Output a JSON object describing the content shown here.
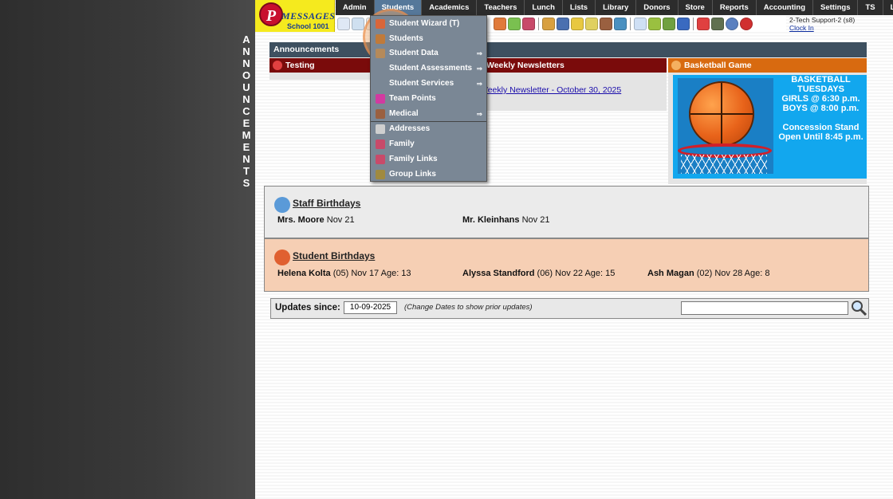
{
  "vertical_title": [
    "A",
    "N",
    "N",
    "O",
    "U",
    "N",
    "C",
    "E",
    "M",
    "E",
    "N",
    "T",
    "S"
  ],
  "logo": {
    "letter": "P",
    "brand": "MESSAGES",
    "school": "School 1001"
  },
  "nav": [
    "Admin",
    "Students",
    "Academics",
    "Teachers",
    "Lunch",
    "Lists",
    "Library",
    "Donors",
    "Store",
    "Reports",
    "Accounting",
    "Settings",
    "TS",
    "Logout"
  ],
  "user": {
    "name": "2-Tech Support-2 (s8)",
    "clock_in": "Clock In"
  },
  "announcements": {
    "title": "Announcements",
    "panels": [
      {
        "title": "Testing",
        "color": "#7a0b0b"
      },
      {
        "title": "Weekly Newsletters",
        "color": "#7a0b0b"
      },
      {
        "title": "Basketball Game",
        "color": "#d86a10"
      }
    ],
    "newsletter_link": "Weekly Newsletter - October 30, 2025",
    "basketball_text": [
      "BASKETBALL",
      "TUESDAYS",
      "GIRLS @ 6:30 p.m.",
      "BOYS  @ 8:00 p.m.",
      "",
      "Concession Stand",
      "Open Until 8:45 p.m."
    ]
  },
  "staff_birthdays": {
    "title": "Staff Birthdays",
    "entries": [
      {
        "name": "Mrs. Moore",
        "detail": "Nov 21"
      },
      {
        "name": "Mr. Kleinhans",
        "detail": "Nov 21"
      }
    ]
  },
  "student_birthdays": {
    "title": "Student Birthdays",
    "entries": [
      {
        "name": "Helena Kolta",
        "detail": "(05) Nov 17 Age: 13"
      },
      {
        "name": "Alyssa Standford",
        "detail": "(06) Nov 22 Age: 15"
      },
      {
        "name": "Ash Magan",
        "detail": "(02) Nov 28 Age: 8"
      }
    ]
  },
  "updates": {
    "label": "Updates since:",
    "date": "10-09-2025",
    "hint": "(Change Dates to show prior updates)",
    "search_placeholder": ""
  },
  "dropdown": {
    "items": [
      {
        "label": "Student Wizard (T)",
        "icon_color": "#d9663a",
        "arrow": false
      },
      {
        "label": "Students",
        "icon_color": "#c07a3a",
        "arrow": false
      },
      {
        "label": "Student Data",
        "icon_color": "#b58a5a",
        "arrow": true
      },
      {
        "label": "Student Assessments",
        "icon_color": "",
        "arrow": true
      },
      {
        "label": "Student Services",
        "icon_color": "",
        "arrow": true
      },
      {
        "label": "Team Points",
        "icon_color": "#d23aa0",
        "arrow": false
      },
      {
        "label": "Medical",
        "icon_color": "#9a6040",
        "arrow": true
      },
      {
        "label": "Addresses",
        "icon_color": "#cfcfcf",
        "arrow": false
      },
      {
        "label": "Family",
        "icon_color": "#c84a6a",
        "arrow": false
      },
      {
        "label": "Family Links",
        "icon_color": "#c84a6a",
        "arrow": false
      },
      {
        "label": "Group Links",
        "icon_color": "#a08a40",
        "arrow": false
      }
    ],
    "arrow_glyph": "⇒"
  }
}
